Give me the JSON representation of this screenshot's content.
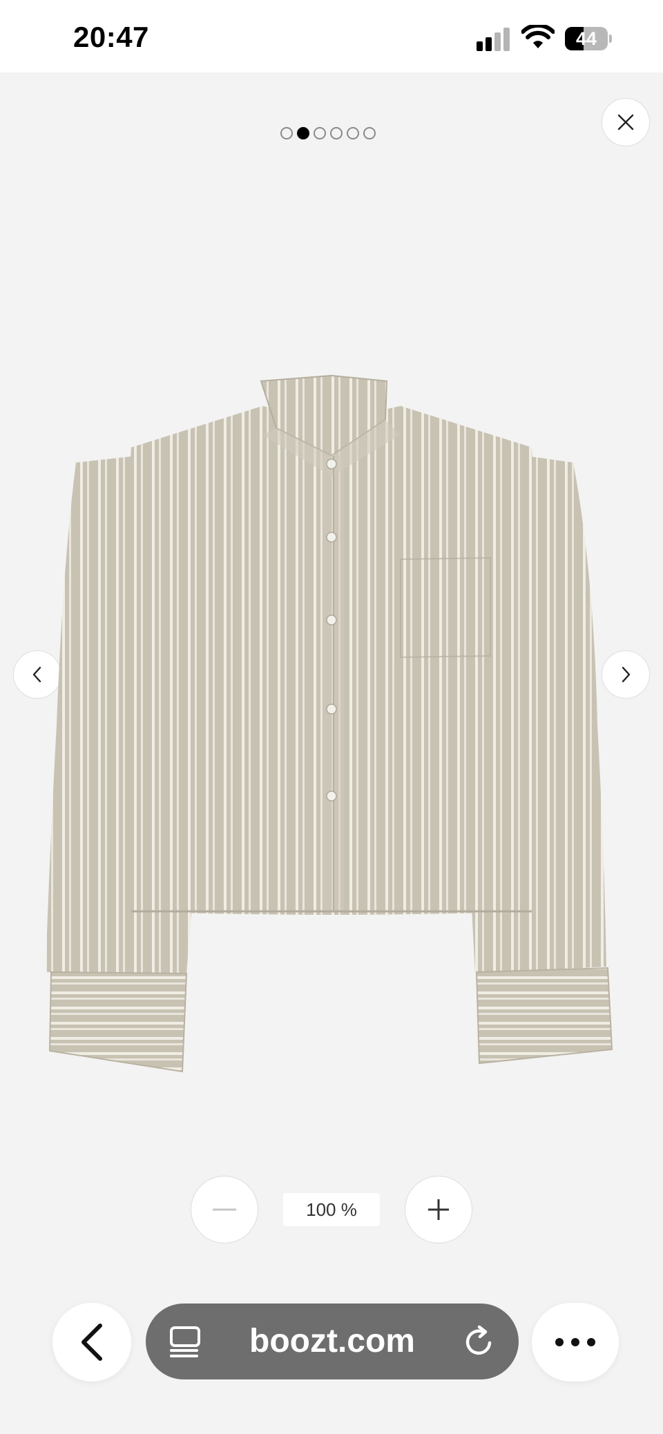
{
  "status_bar": {
    "time": "20:47",
    "battery_level": "44",
    "battery_fraction": 0.44,
    "signal_bars_active": 2,
    "signal_bars_total": 4
  },
  "gallery": {
    "image_count": 6,
    "active_index": 1,
    "image_alt": "Striped cropped shirt",
    "colors": {
      "background": "#f3f3f3",
      "shirt_base": "#c9c3b4",
      "stripe": "#f1eee6"
    }
  },
  "zoom": {
    "level": "100 %"
  },
  "browser": {
    "url": "boozt.com"
  }
}
